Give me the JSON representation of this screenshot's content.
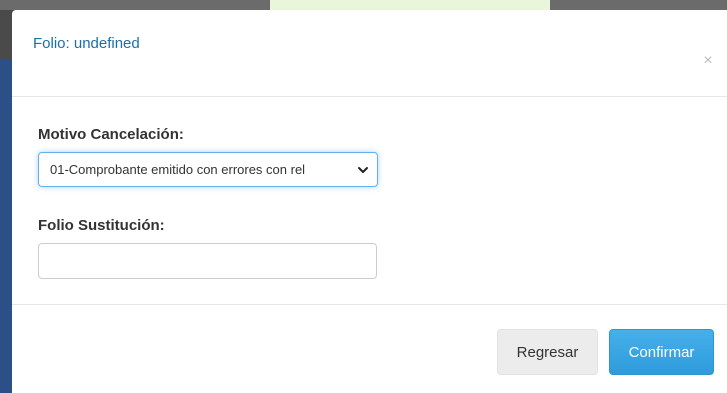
{
  "modal": {
    "title": "Folio: undefined",
    "close_symbol": "×"
  },
  "form": {
    "motivo_label": "Motivo Cancelación:",
    "motivo_selected": "01-Comprobante emitido con errores con rel",
    "folio_label": "Folio Sustitución:",
    "folio_value": ""
  },
  "footer": {
    "back_label": "Regresar",
    "confirm_label": "Confirmar"
  },
  "icons": {
    "close": "close-icon",
    "select_arrow": "chevron-down-icon"
  },
  "colors": {
    "title": "#1a6fa8",
    "confirm_button": "#3aa6e4",
    "back_button": "#ececec",
    "focus_border": "#66afe9"
  }
}
